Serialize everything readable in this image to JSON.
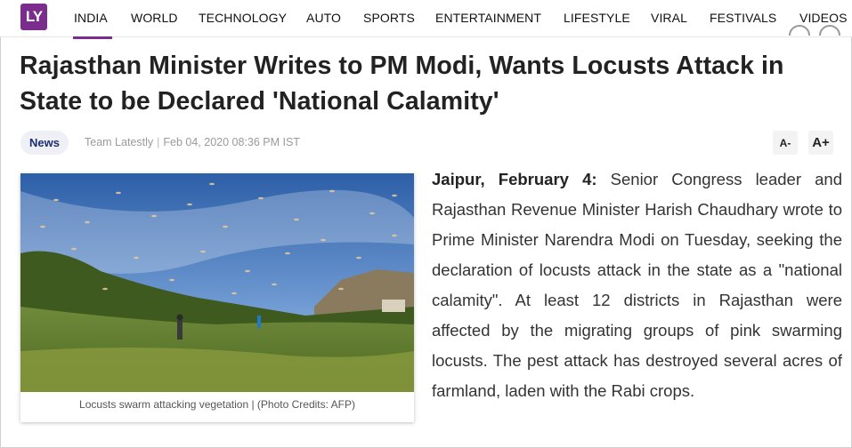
{
  "brand": {
    "logo_text": "LY",
    "color": "#7a2d8d"
  },
  "nav": {
    "items": [
      {
        "label": "INDIA",
        "active": true
      },
      {
        "label": "WORLD"
      },
      {
        "label": "TECHNOLOGY"
      },
      {
        "label": "AUTO"
      },
      {
        "label": "SPORTS"
      },
      {
        "label": "ENTERTAINMENT"
      },
      {
        "label": "LIFESTYLE"
      },
      {
        "label": "VIRAL"
      },
      {
        "label": "FESTIVALS"
      },
      {
        "label": "VIDEOS"
      }
    ]
  },
  "article": {
    "title": "Rajasthan Minister Writes to PM Modi, Wants Locusts Attack in State to be Declared 'National Calamity'",
    "category": "News",
    "author": "Team Latestly",
    "date": "Feb 04, 2020 08:36 PM IST",
    "font_controls": {
      "decrease": "A-",
      "increase": "A+"
    },
    "image_caption": "Locusts swarm attacking vegetation | (Photo Credits: AFP)",
    "dateline": "Jaipur, February 4:",
    "body": "Senior Congress leader and Rajasthan Revenue Minister Harish Chaudhary wrote to Prime Minister Narendra Modi on Tuesday, seeking the declaration of locusts attack in the state as a \"national calamity\". At least 12 districts in Rajasthan were affected by the migrating groups of pink swarming locusts. The pest attack has destroyed several acres of farmland, laden with the Rabi crops."
  },
  "colors": {
    "accent": "#7a2d8d",
    "badge_text": "#1c2e6e",
    "meta_text": "#9a9a9a"
  }
}
